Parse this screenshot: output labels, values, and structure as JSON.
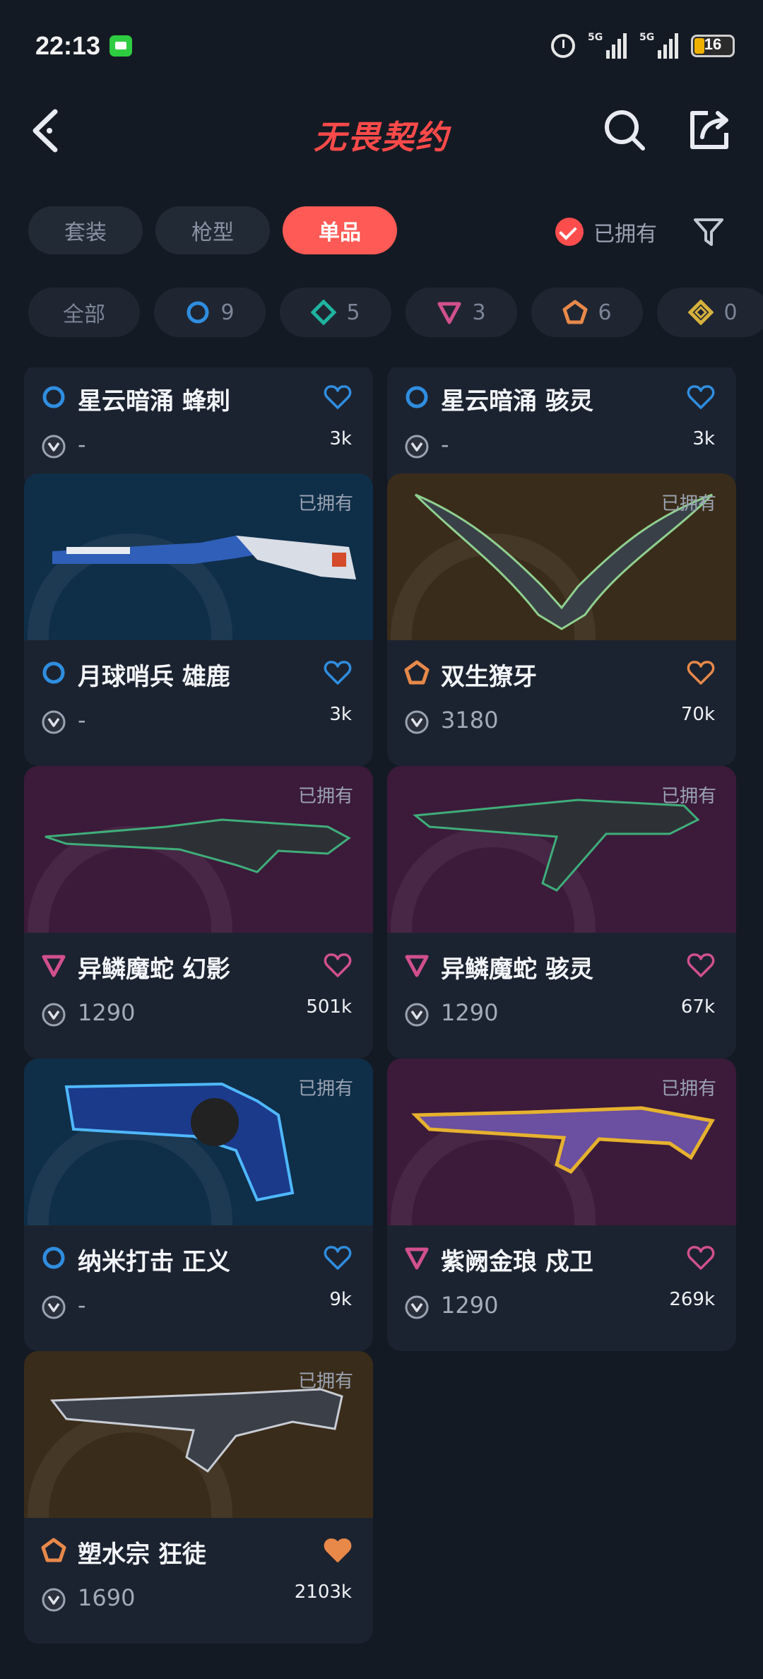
{
  "status_bar": {
    "time": "22:13",
    "battery": "16",
    "signal1_label": "5G",
    "signal2_label": "5G"
  },
  "header": {
    "title": "无畏契约"
  },
  "tabs": [
    {
      "label": "套装",
      "active": false
    },
    {
      "label": "枪型",
      "active": false
    },
    {
      "label": "单品",
      "active": true
    }
  ],
  "owned_filter": {
    "label": "已拥有"
  },
  "chips": [
    {
      "label": "全部",
      "icon": "all",
      "count": ""
    },
    {
      "label": "",
      "icon": "select-tier-icon",
      "color": "#2f8ee0",
      "count": "9"
    },
    {
      "label": "",
      "icon": "deluxe-tier-icon",
      "color": "#1fb3a0",
      "count": "5"
    },
    {
      "label": "",
      "icon": "premium-tier-icon",
      "color": "#d1508e",
      "count": "3"
    },
    {
      "label": "",
      "icon": "exclusive-tier-icon",
      "color": "#e8894a",
      "count": "6"
    },
    {
      "label": "",
      "icon": "ultra-tier-icon",
      "color": "#d6b13c",
      "count": "0"
    }
  ],
  "cards": [
    {
      "name": "星云暗涌 蜂刺",
      "price": "-",
      "likes": "3k",
      "tier": "select",
      "owned": "",
      "partial": true
    },
    {
      "name": "星云暗涌 骇灵",
      "price": "-",
      "likes": "3k",
      "tier": "select",
      "owned": "",
      "partial": true
    },
    {
      "name": "月球哨兵 雄鹿",
      "price": "-",
      "likes": "3k",
      "tier": "select",
      "owned": "已拥有",
      "weapon": "shotgun"
    },
    {
      "name": "双生獠牙",
      "price": "3180",
      "likes": "70k",
      "tier": "exclusive",
      "owned": "已拥有",
      "weapon": "melee"
    },
    {
      "name": "异鳞魔蛇 幻影",
      "price": "1290",
      "likes": "501k",
      "tier": "premium",
      "owned": "已拥有",
      "weapon": "rifle"
    },
    {
      "name": "异鳞魔蛇 骇灵",
      "price": "1290",
      "likes": "67k",
      "tier": "premium",
      "owned": "已拥有",
      "weapon": "smg"
    },
    {
      "name": "纳米打击 正义",
      "price": "-",
      "likes": "9k",
      "tier": "select",
      "owned": "已拥有",
      "weapon": "revolver"
    },
    {
      "name": "紫阙金琅 戍卫",
      "price": "1290",
      "likes": "269k",
      "tier": "premium",
      "owned": "已拥有",
      "weapon": "gold-rifle"
    },
    {
      "name": "塑水宗 狂徒",
      "price": "1690",
      "likes": "2103k",
      "tier": "exclusive",
      "owned": "已拥有",
      "weapon": "vandal",
      "liked": true
    }
  ],
  "tier_colors": {
    "select": "#2f8ee0",
    "premium": "#d1508e",
    "exclusive": "#e8894a",
    "deluxe": "#1fb3a0",
    "ultra": "#d6b13c"
  },
  "tier_bg": {
    "select": "#0f2e48",
    "premium": "#3c1a3a",
    "exclusive": "#3a2c1a"
  }
}
